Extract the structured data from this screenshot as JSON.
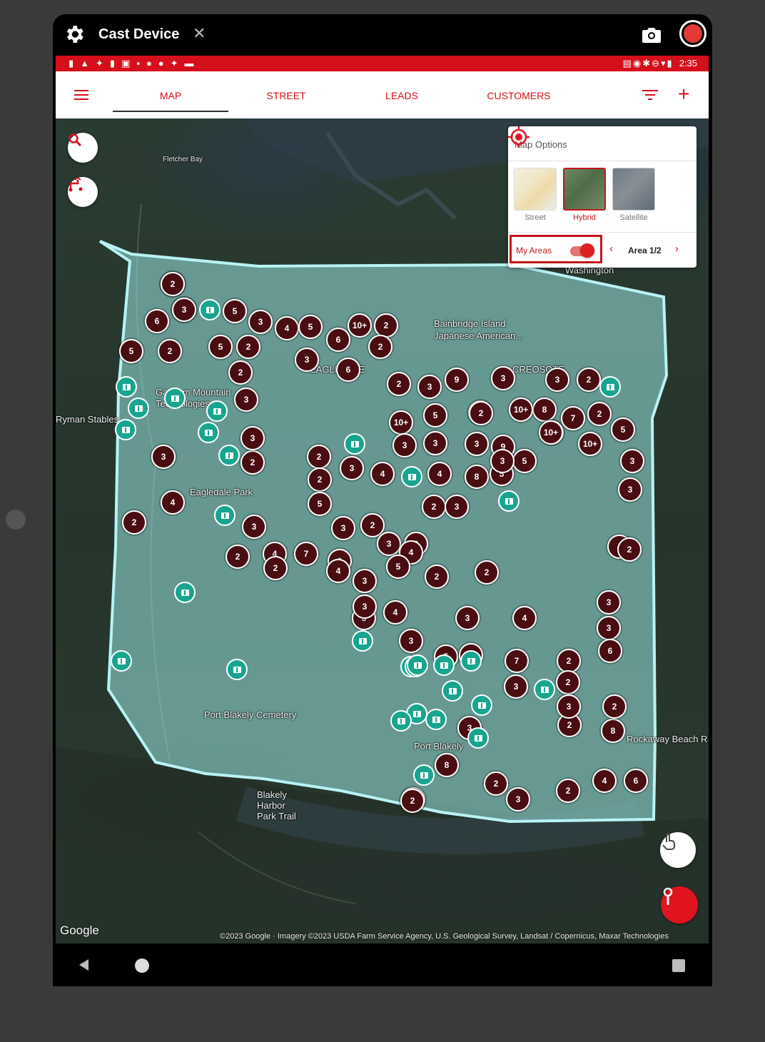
{
  "cast": {
    "title": "Cast Device",
    "close_symbol": "✕",
    "icons": [
      "gear-icon",
      "camera-icon",
      "record-icon"
    ]
  },
  "status_bar": {
    "time": "2:35",
    "color": "#d50f1b"
  },
  "tabs": [
    "MAP",
    "STREET",
    "LEADS",
    "CUSTOMERS"
  ],
  "active_tab": "MAP",
  "appbar_actions": [
    "menu-icon",
    "filter-icon",
    "add-icon"
  ],
  "add_symbol": "+",
  "map_options": {
    "title": "Map Options",
    "types": [
      {
        "label": "Street",
        "selected": false
      },
      {
        "label": "Hybrid",
        "selected": true
      },
      {
        "label": "Satellite",
        "selected": false
      }
    ],
    "my_areas_label": "My Areas",
    "my_areas_on": true,
    "area_label": "Area 1/2",
    "prev_symbol": "‹",
    "next_symbol": "›"
  },
  "map_labels": [
    "Bainbridge Island",
    "Japanese American...",
    "Eagledale Park",
    "Gazzam Mountain",
    "Technologies",
    "Port Blakely Cemetery",
    "Port Blakely",
    "Rockaway Beach R",
    "Blakely Harbor Park Trail",
    "CREOSOTE",
    "EAGLEDALE",
    "Fletcher Bay",
    "Washington",
    "Ryman Stables"
  ],
  "clusters": [
    "6",
    "4",
    "6",
    "5",
    "3",
    "4",
    "5",
    "10+",
    "2",
    "6",
    "2",
    "5",
    "2",
    "5",
    "2",
    "6",
    "2",
    "3",
    "3",
    "2",
    "3",
    "9",
    "3",
    "3",
    "2",
    "8",
    "10+",
    "5",
    "2",
    "10+",
    "8",
    "7",
    "2",
    "5",
    "3",
    "3",
    "3",
    "5",
    "9",
    "10+",
    "10+",
    "3",
    "3",
    "2",
    "2",
    "2",
    "3",
    "3",
    "3",
    "4",
    "4",
    "8",
    "5",
    "3",
    "2",
    "4",
    "2",
    "3",
    "5",
    "3",
    "2",
    "3",
    "2",
    "4",
    "2",
    "3",
    "2",
    "2",
    "4",
    "7",
    "4",
    "3",
    "5",
    "3",
    "2",
    "4",
    "3",
    "5",
    "3",
    "2",
    "2",
    "3",
    "3",
    "4",
    "3",
    "3",
    "6",
    "4",
    "2",
    "3",
    "7",
    "2",
    "2",
    "8",
    "2",
    "3",
    "2",
    "3",
    "8",
    "2",
    "2",
    "3",
    "2",
    "4",
    "6",
    "2",
    "2",
    "3"
  ],
  "markers": 30,
  "fab_icons": [
    "search-icon",
    "route-icon",
    "touch-icon",
    "pin-drop-icon"
  ],
  "google_logo": "Google",
  "attribution": "©2023 Google · Imagery ©2023 USDA Farm Service Agency, U.S. Geological Survey, Landsat / Copernicus, Maxar Technologies",
  "nav_icons": [
    "back-icon",
    "home-icon",
    "recents-icon"
  ]
}
